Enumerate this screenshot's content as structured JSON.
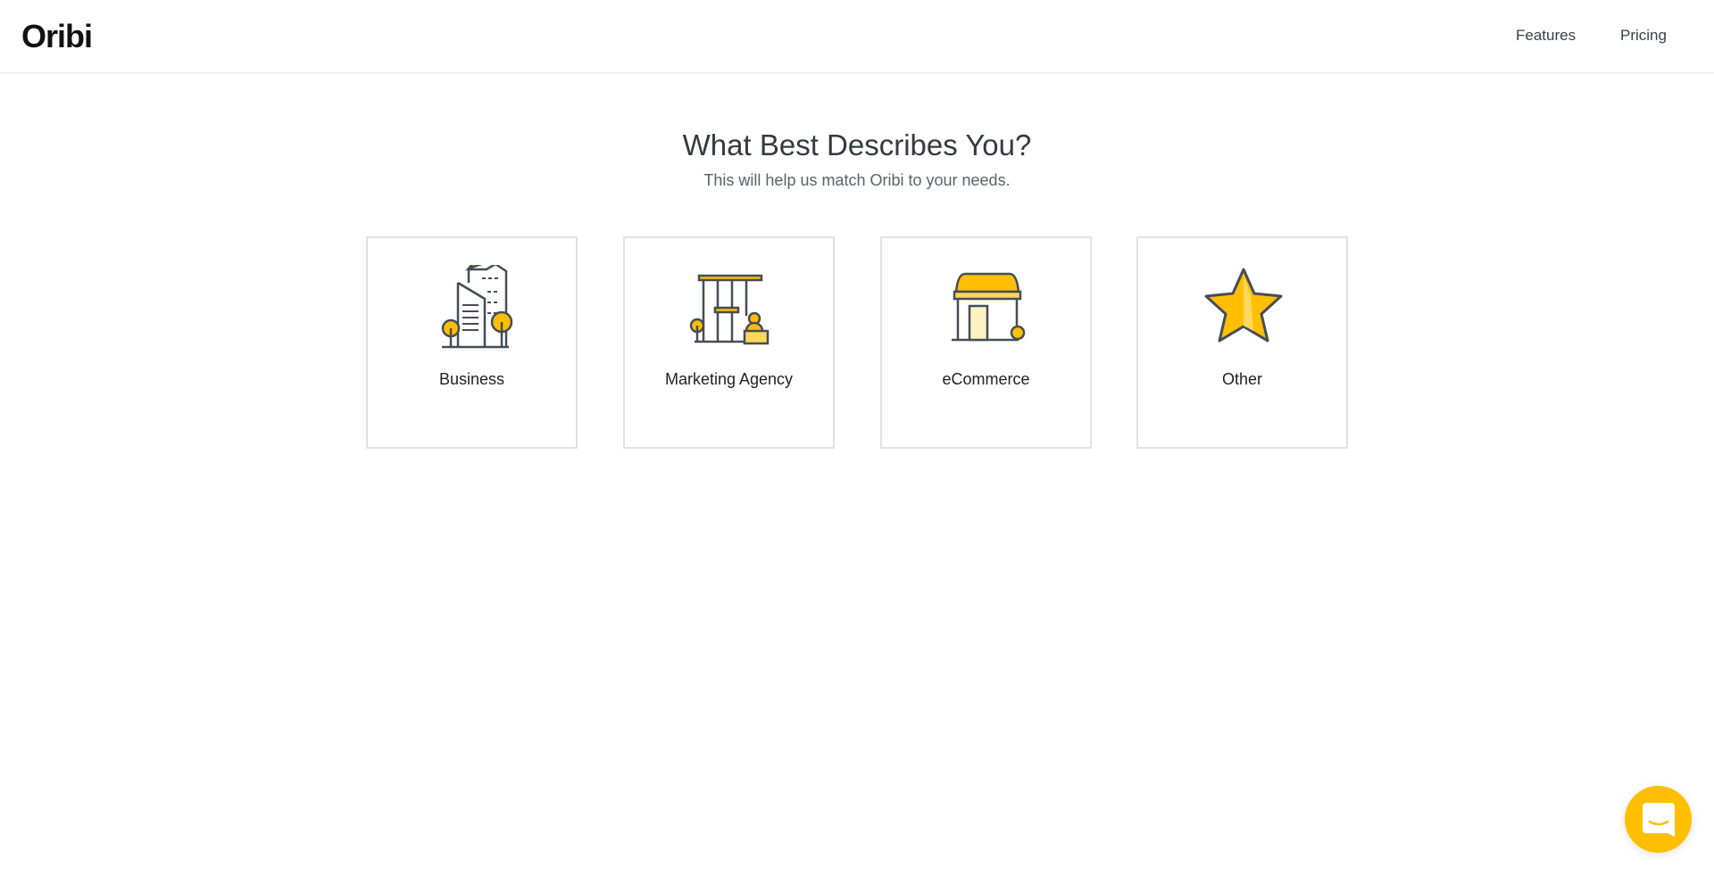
{
  "header": {
    "logo": "Oribi",
    "nav": [
      {
        "label": "Features"
      },
      {
        "label": "Pricing"
      }
    ]
  },
  "main": {
    "title": "What Best Describes You?",
    "subtitle": "This will help us match Oribi to your needs.",
    "options": [
      {
        "label": "Business",
        "icon": "buildings-icon"
      },
      {
        "label": "Marketing Agency",
        "icon": "agency-office-icon"
      },
      {
        "label": "eCommerce",
        "icon": "storefront-icon"
      },
      {
        "label": "Other",
        "icon": "star-icon"
      }
    ]
  },
  "chat": {
    "icon": "chat-smile-icon"
  },
  "colors": {
    "accent": "#ffbf00",
    "text": "#333a42",
    "border": "#dfe1e5"
  }
}
